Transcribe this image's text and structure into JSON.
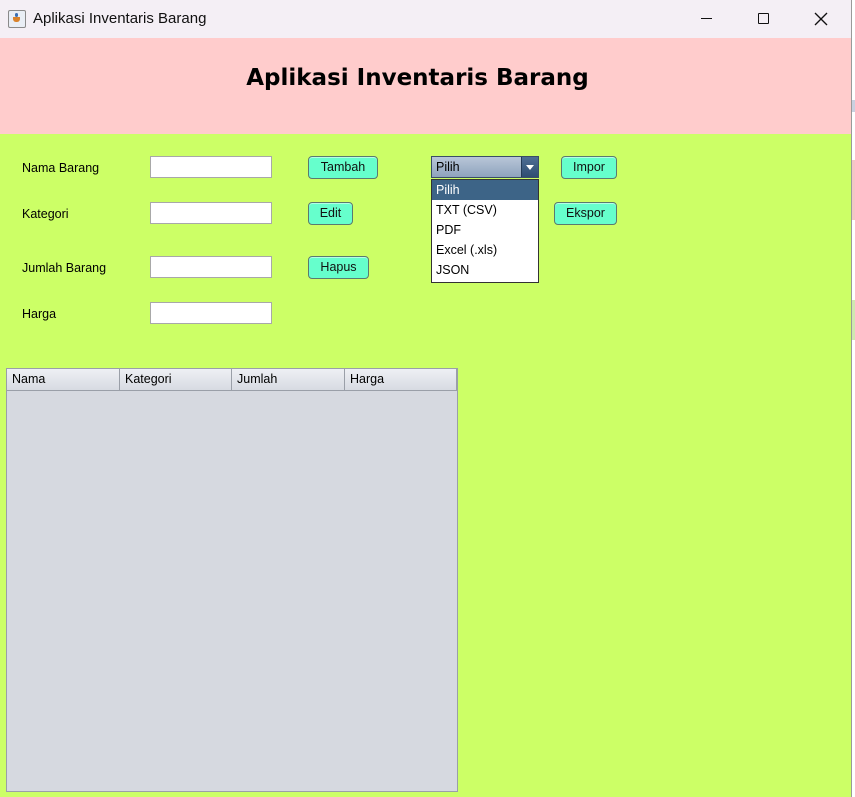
{
  "window": {
    "title": "Aplikasi Inventaris Barang",
    "icon": "java-cup-icon",
    "controls": [
      "minimize-icon",
      "maximize-icon",
      "close-icon"
    ]
  },
  "header": {
    "title": "Aplikasi Inventaris Barang",
    "background": "#ffcccc"
  },
  "form": {
    "background": "#ccff66",
    "fields": [
      {
        "label": "Nama Barang",
        "value": ""
      },
      {
        "label": "Kategori",
        "value": ""
      },
      {
        "label": "Jumlah Barang",
        "value": ""
      },
      {
        "label": "Harga",
        "value": ""
      }
    ]
  },
  "buttons": {
    "tambah": "Tambah",
    "edit": "Edit",
    "hapus": "Hapus",
    "impor": "Impor",
    "ekspor": "Ekspor",
    "color": "#66ffcc"
  },
  "format_select": {
    "value": "Pilih",
    "expanded": true,
    "options": [
      "Pilih",
      "TXT (CSV)",
      "PDF",
      "Excel (.xls)",
      "JSON"
    ],
    "selected_index": 0
  },
  "table": {
    "columns": [
      "Nama",
      "Kategori",
      "Jumlah",
      "Harga"
    ],
    "rows": []
  }
}
